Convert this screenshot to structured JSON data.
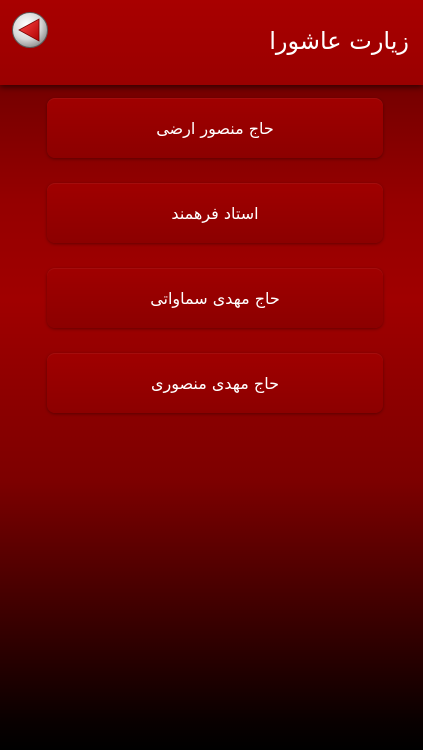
{
  "header": {
    "title": "زیارت عاشورا",
    "back_icon": "back-arrow-icon"
  },
  "menu": {
    "items": [
      {
        "label": "حاج منصور ارضی"
      },
      {
        "label": "استاد فرهمند"
      },
      {
        "label": "حاج مهدی سماواتی"
      },
      {
        "label": "حاج مهدی منصوری"
      }
    ]
  },
  "colors": {
    "header_bg": "#a80000",
    "item_bg": "#9a0000",
    "text": "#ffffff"
  }
}
